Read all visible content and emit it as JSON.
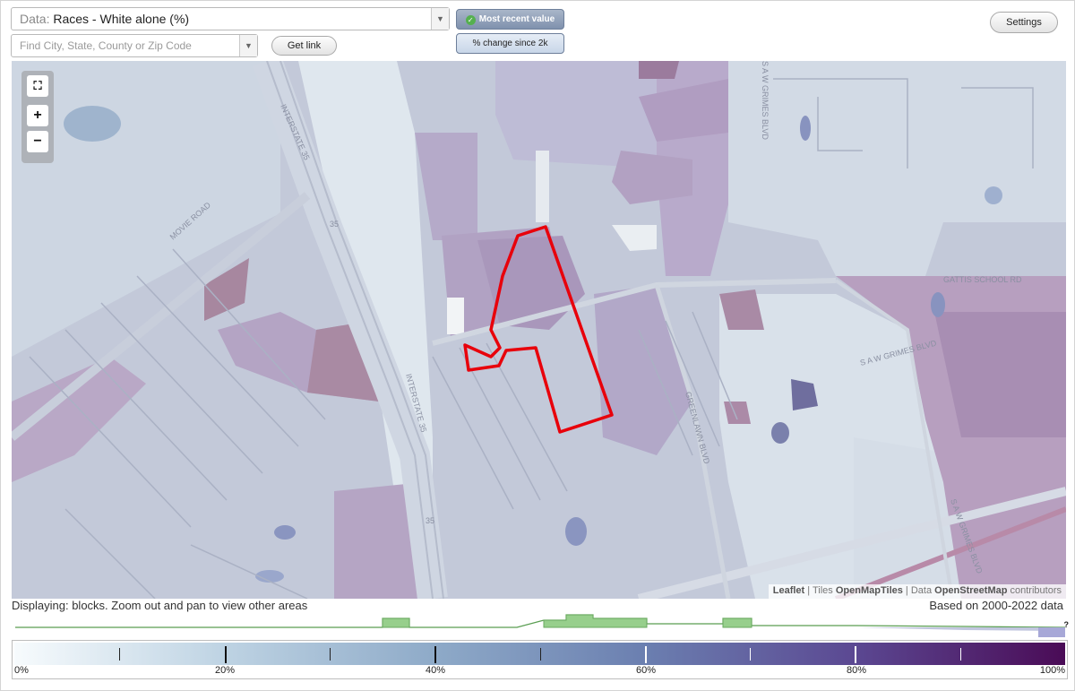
{
  "toolbar": {
    "data_prefix": "Data:",
    "data_value": "Races - White alone (%)",
    "search_placeholder": "Find City, State, County or Zip Code",
    "get_link_label": "Get link",
    "most_recent_label": "Most recent value",
    "change_label": "% change since 2k",
    "settings_label": "Settings"
  },
  "map": {
    "road_labels": [
      "INTERSTATE 35",
      "35",
      "INTERSTATE 35",
      "35",
      "MOVIE ROAD",
      "S A W GRIMES BLVD",
      "GATTIS SCHOOL RD",
      "S A W GRIMES BLVD",
      "GREENLAWN BLVD",
      "S A W GRIMES BLVD"
    ],
    "attribution": {
      "leaflet": "Leaflet",
      "tiles_prefix": "Tiles",
      "tiles_name": "OpenMapTiles",
      "data_prefix": "Data",
      "data_name": "OpenStreetMap",
      "data_suffix": "contributors"
    },
    "highlight_color": "#e8000b"
  },
  "footer": {
    "display_note": "Displaying: blocks. Zoom out and pan to view other areas",
    "based_on": "Based on 2000-2022 data",
    "unknown_mark": "?",
    "legend_labels": [
      "0%",
      "20%",
      "40%",
      "60%",
      "80%",
      "100%"
    ]
  }
}
